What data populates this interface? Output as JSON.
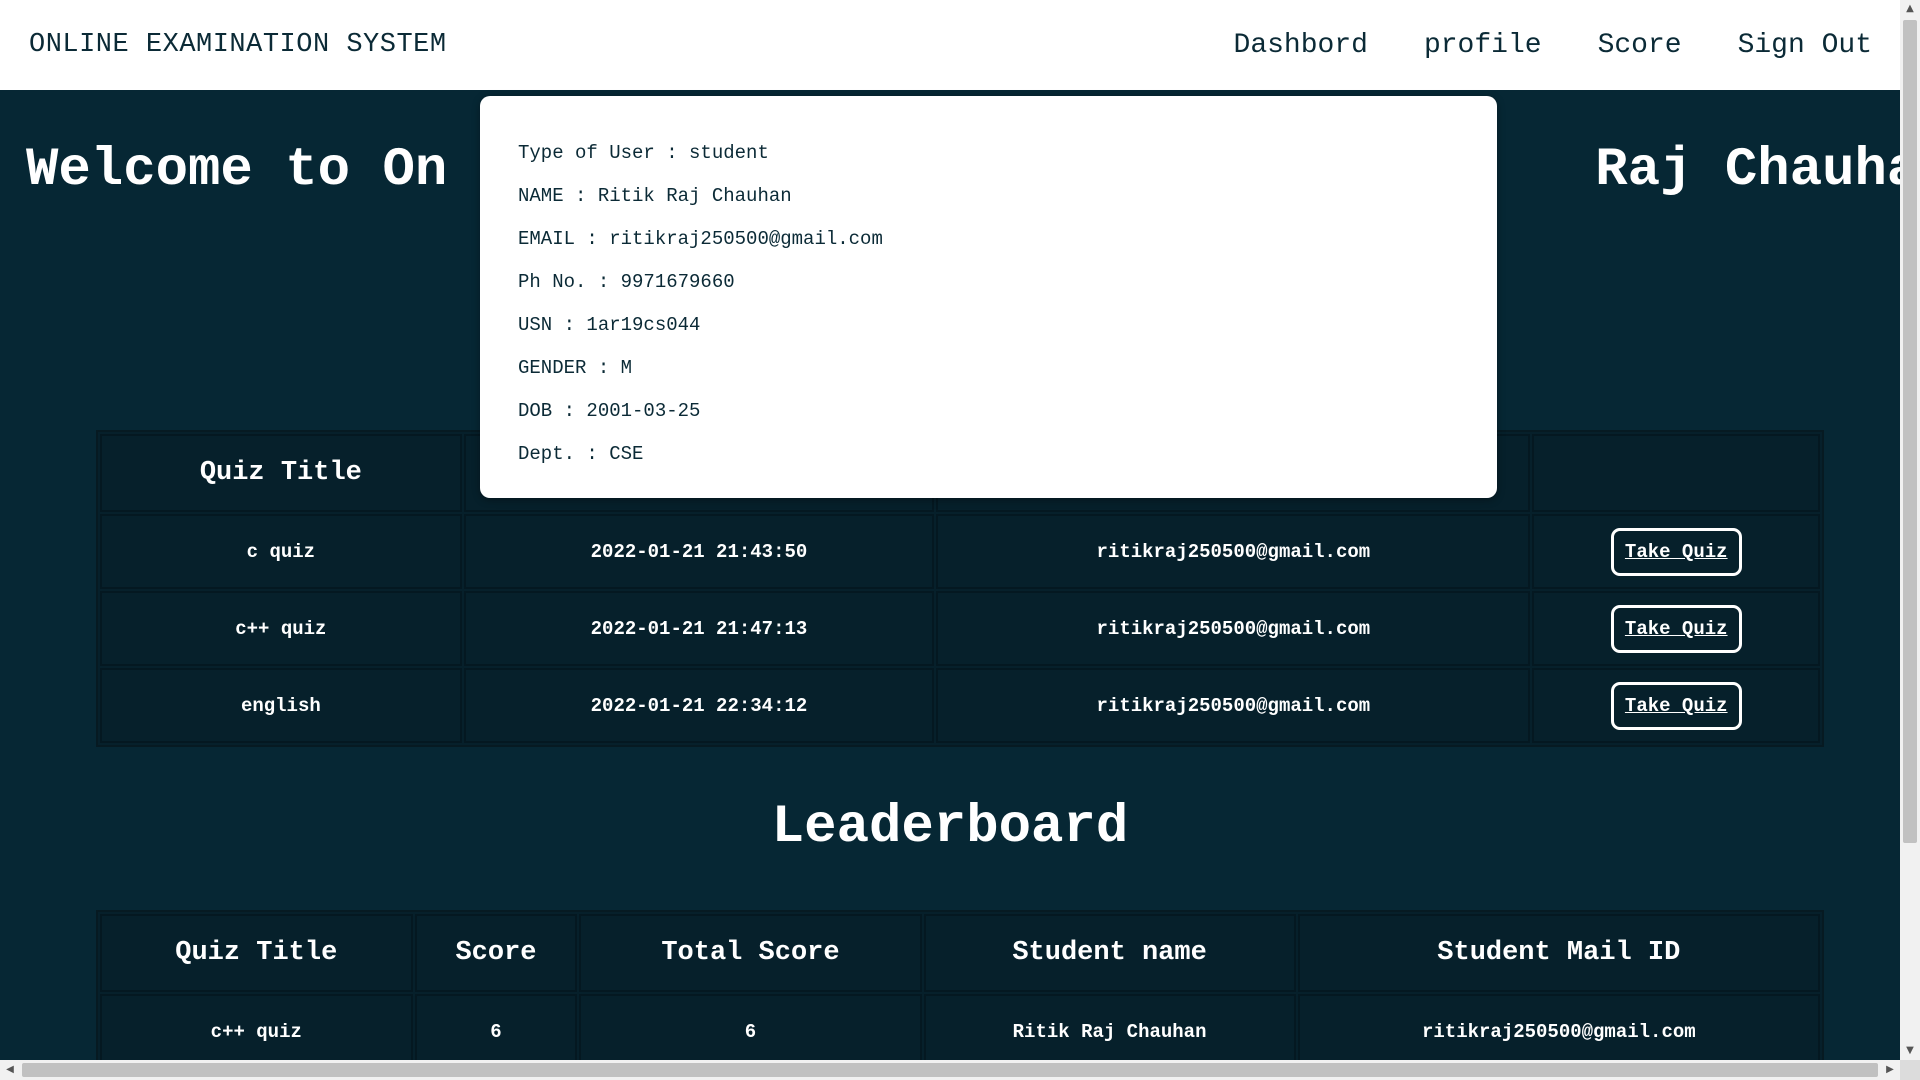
{
  "nav": {
    "brand": "ONLINE EXAMINATION SYSTEM",
    "links": [
      "Dashbord",
      "profile",
      "Score",
      "Sign Out"
    ]
  },
  "welcome": {
    "left": "Welcome to On",
    "right": "Raj Chauhan"
  },
  "profile": {
    "type_of_user": "Type of User : student",
    "name": "NAME : Ritik Raj Chauhan",
    "email": "EMAIL : ritikraj250500@gmail.com",
    "phone": "Ph No. : 9971679660",
    "usn": "USN : 1ar19cs044",
    "gender": "GENDER : M",
    "dob": "DOB : 2001-03-25",
    "dept": "Dept. : CSE"
  },
  "quiz_table": {
    "header_title": "Quiz Title",
    "rows": [
      {
        "title": "c quiz",
        "created": "2022-01-21 21:43:50",
        "email": "ritikraj250500@gmail.com",
        "action": "Take Quiz"
      },
      {
        "title": "c++ quiz",
        "created": "2022-01-21 21:47:13",
        "email": "ritikraj250500@gmail.com",
        "action": "Take Quiz"
      },
      {
        "title": "english",
        "created": "2022-01-21 22:34:12",
        "email": "ritikraj250500@gmail.com",
        "action": "Take Quiz"
      }
    ]
  },
  "leaderboard": {
    "title": "Leaderboard",
    "headers": [
      "Quiz Title",
      "Score",
      "Total Score",
      "Student name",
      "Student Mail ID"
    ],
    "rows": [
      {
        "quiz": "c++ quiz",
        "score": "6",
        "total": "6",
        "name": "Ritik Raj Chauhan",
        "mail": "ritikraj250500@gmail.com"
      }
    ]
  },
  "scrollbar": {
    "up_arrow": "▲",
    "down_arrow": "▼",
    "left_arrow": "◀",
    "right_arrow": "▶"
  }
}
